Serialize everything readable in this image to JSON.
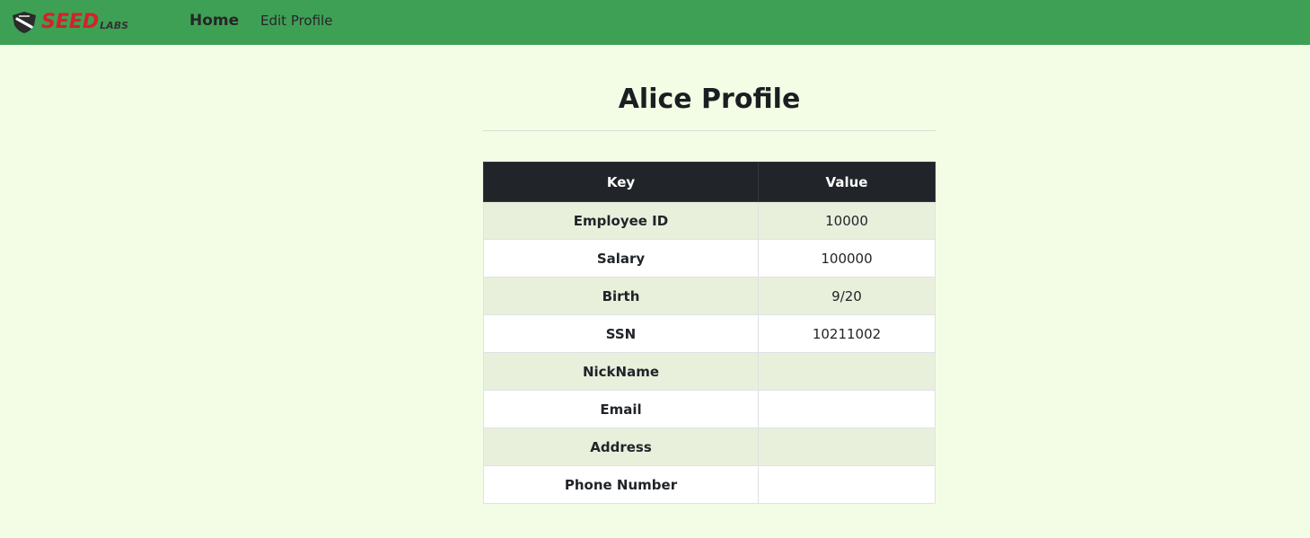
{
  "nav": {
    "brand": {
      "seed_text": "SEED",
      "labs_text": "LABS",
      "accent_color": "#d6202a"
    },
    "home_label": "Home",
    "edit_profile_label": "Edit Profile",
    "bar_color": "#3ea055"
  },
  "page": {
    "title": "Alice Profile",
    "background": "#f3fde5"
  },
  "table": {
    "headers": [
      "Key",
      "Value"
    ],
    "rows": [
      {
        "key": "Employee ID",
        "value": "10000"
      },
      {
        "key": "Salary",
        "value": "100000"
      },
      {
        "key": "Birth",
        "value": "9/20"
      },
      {
        "key": "SSN",
        "value": "10211002"
      },
      {
        "key": "NickName",
        "value": ""
      },
      {
        "key": "Email",
        "value": ""
      },
      {
        "key": "Address",
        "value": ""
      },
      {
        "key": "Phone Number",
        "value": ""
      }
    ]
  }
}
